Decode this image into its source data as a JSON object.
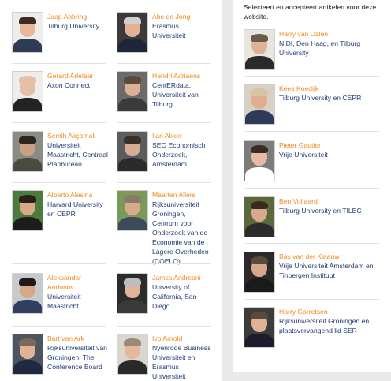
{
  "left_people": [
    {
      "name": "Jaap Abbring",
      "affiliation": "Tilburg University",
      "photo": {
        "bg": "#ededed",
        "skin": "#e9b89b",
        "hair": "#3a2c22",
        "body": "#2f3a55"
      }
    },
    {
      "name": "Abe de Jong",
      "affiliation": "Erasmus Universiteit",
      "photo": {
        "bg": "#3c3a3a",
        "skin": "#e3b194",
        "hair": "#cfcfcf",
        "body": "#1e2738"
      }
    },
    {
      "name": "Gerard Adelaar",
      "affiliation": "Axon Connect",
      "photo": {
        "bg": "#ededed",
        "skin": "#e5bfa6",
        "hair": "#e5bfa6",
        "body": "#222222"
      }
    },
    {
      "name": "Hendri Adriaens",
      "affiliation": "CentERdata, Universiteit van Tilburg",
      "photo": {
        "bg": "#6b6b6b",
        "skin": "#ddb096",
        "hair": "#5b4a3a",
        "body": "#3a3a3a"
      }
    },
    {
      "name": "Semih Akçomak",
      "affiliation": "Universiteit Maastricht, Centraal Planbureau",
      "photo": {
        "bg": "#8a8b83",
        "skin": "#c9a083",
        "hair": "#2d2520",
        "body": "#4a4a40"
      }
    },
    {
      "name": "Ilan Akker",
      "affiliation": "SEO Economisch Onderzoek, Amsterdam",
      "photo": {
        "bg": "#5c5c5c",
        "skin": "#d7ad96",
        "hair": "#3b2f26",
        "body": "#2b2b2b"
      }
    },
    {
      "name": "Alberto Alesina",
      "affiliation": "Harvard University en CEPR",
      "photo": {
        "bg": "#4a7d3d",
        "skin": "#d9a887",
        "hair": "#2a2018",
        "body": "#1d1d1d"
      }
    },
    {
      "name": "Maarten Allers",
      "affiliation": "Rijksuniversiteit Groningen, Centrum voor Onderzoek van de Economie van de Lagere Overheden (COELO)",
      "photo": {
        "bg": "#7a9a5a",
        "skin": "#d9a98c",
        "hair": "#8a7a6a",
        "body": "#3c4a5a"
      }
    },
    {
      "name": "Aleksandar Andonov",
      "affiliation": "Universiteit Maastricht",
      "photo": {
        "bg": "#c7c9cc",
        "skin": "#d6a887",
        "hair": "#1f1a16",
        "body": "#2f3f5f"
      }
    },
    {
      "name": "James Andreoni",
      "affiliation": "University of California, San Diego",
      "photo": {
        "bg": "#2c2c2c",
        "skin": "#e0b59a",
        "hair": "#bdbdbd",
        "body": "#3a3a3a"
      }
    },
    {
      "name": "Bart van Ark",
      "affiliation": "Rijksuniversiteit van Groningen, The Conference Board",
      "photo": {
        "bg": "#4d5560",
        "skin": "#e1b395",
        "hair": "#7a6a5a",
        "body": "#1f2a3f"
      }
    },
    {
      "name": "Ivo Arnold",
      "affiliation": "Nyenrode Business Universiteit en Erasmus Universiteit Rotterdam",
      "photo": {
        "bg": "#d9d6d0",
        "skin": "#e3b89d",
        "hair": "#9a8a78",
        "body": "#2a2a2a"
      }
    }
  ],
  "intro_text": "Selecteert en accepteert artikelen voor deze website.",
  "right_people": [
    {
      "name": "Harry van Dalen",
      "affiliation": "NIDI, Den Haag, en Tilburg University",
      "photo": {
        "bg": "#e8e5df",
        "skin": "#e0b295",
        "hair": "#6a5a4a",
        "body": "#2a2a2a"
      }
    },
    {
      "name": "Kees Koedijk",
      "affiliation": "Tilburg University en CEPR",
      "photo": {
        "bg": "#d8cfc5",
        "skin": "#e0ad8f",
        "hair": "#d6c4a6",
        "body": "#2d3a5a"
      }
    },
    {
      "name": "Pieter Gautier",
      "affiliation": "Vrije Universiteit",
      "photo": {
        "bg": "#7c7c7c",
        "skin": "#e5bca3",
        "hair": "#3a2c22",
        "body": "#ffffff"
      }
    },
    {
      "name": "Ben Vollaard",
      "affiliation": "Tilburg University en TILEC",
      "photo": {
        "bg": "#5b6a3c",
        "skin": "#d9a98a",
        "hair": "#3a2a1a",
        "body": "#2b2b2b"
      }
    },
    {
      "name": "Bas van der Klaauw",
      "affiliation": "Vrije Universiteit Amsterdam en Tinbergen Instituut",
      "photo": {
        "bg": "#2a2a2a",
        "skin": "#d6a98d",
        "hair": "#5a4a3a",
        "body": "#1a1a1a"
      }
    },
    {
      "name": "Harry Garretsen",
      "affiliation": "Rijksuniversiteit Groningen en plaatsvervangend lid SER",
      "photo": {
        "bg": "#3c3c3c",
        "skin": "#e0b398",
        "hair": "#5a4a3a",
        "body": "#1c1c2a"
      }
    }
  ],
  "colors": {
    "name": "#f08a21",
    "affiliation": "#1f3a73",
    "separator": "#e2e2e2"
  }
}
